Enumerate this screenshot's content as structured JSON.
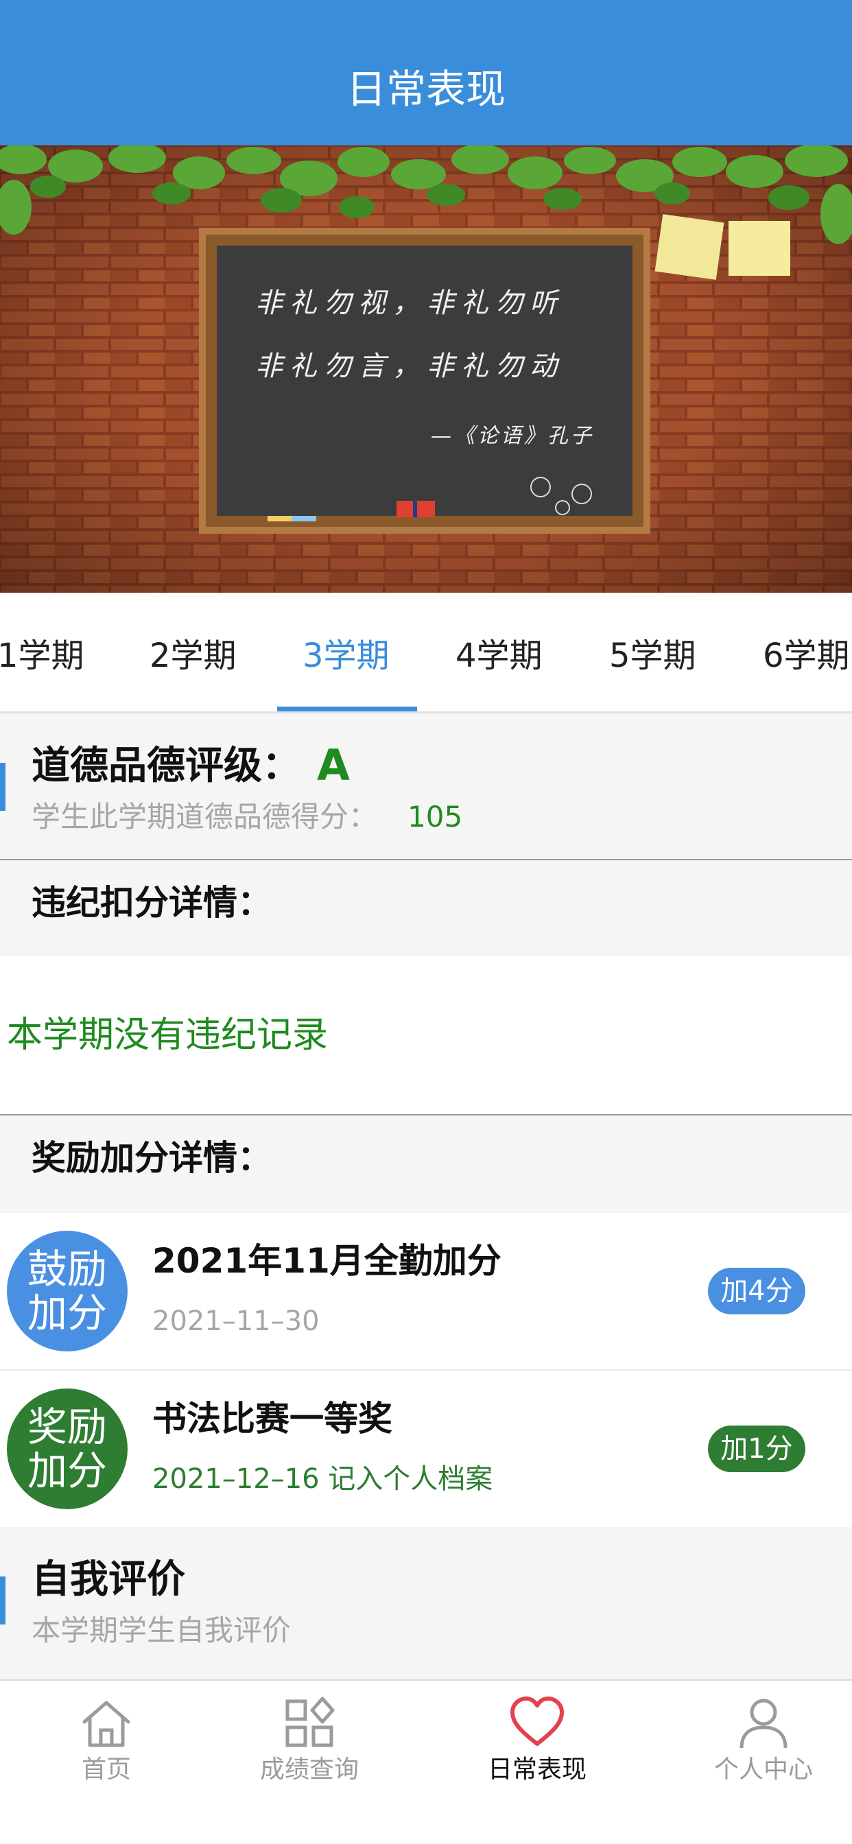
{
  "header": {
    "title": "日常表现"
  },
  "banner": {
    "line1": "非礼勿视，非礼勿听",
    "line2": "非礼勿言，非礼勿动",
    "attribution": "—《论语》孔子"
  },
  "tabs": [
    {
      "label": "1学期"
    },
    {
      "label": "2学期"
    },
    {
      "label": "3学期",
      "active": true
    },
    {
      "label": "4学期"
    },
    {
      "label": "5学期"
    },
    {
      "label": "6学期"
    }
  ],
  "moral": {
    "title": "道德品德评级：",
    "grade": "A",
    "score_label": "学生此学期道德品德得分：",
    "score": "105"
  },
  "violations": {
    "title": "违纪扣分详情：",
    "empty_text": "本学期没有违纪记录"
  },
  "rewards": {
    "title": "奖励加分详情：",
    "items": [
      {
        "badge_line1": "鼓励",
        "badge_line2": "加分",
        "title": "2021年11月全勤加分",
        "date": "2021–11–30",
        "points": "加4分",
        "color": "#4a90e2"
      },
      {
        "badge_line1": "奖励",
        "badge_line2": "加分",
        "title": "书法比赛一等奖",
        "date": "2021–12–16 记入个人档案",
        "points": "加1分",
        "color": "#2e7d32"
      }
    ]
  },
  "self_eval": {
    "title": "自我评价",
    "subtitle": "本学期学生自我评价"
  },
  "nav": {
    "items": [
      {
        "label": "首页",
        "icon": "home-icon"
      },
      {
        "label": "成绩查询",
        "icon": "grid-icon"
      },
      {
        "label": "日常表现",
        "icon": "heart-icon",
        "active": true
      },
      {
        "label": "个人中心",
        "icon": "user-icon"
      }
    ]
  },
  "colors": {
    "primary": "#3a8ddb",
    "green": "#2e7d32",
    "grade_green": "#1f8a1f"
  }
}
